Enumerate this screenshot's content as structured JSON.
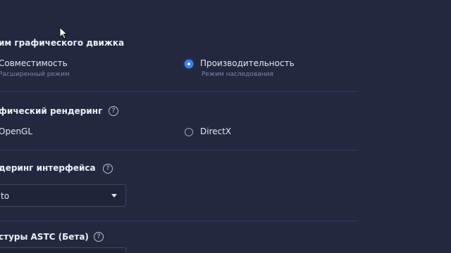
{
  "engine_mode": {
    "title": "им графического движка",
    "options": [
      {
        "label": "Совместимость",
        "sublabel": "Расширенный режим",
        "selected": false
      },
      {
        "label": "Производительность",
        "sublabel": "Режим наследования",
        "selected": true
      }
    ]
  },
  "graphics_rendering": {
    "title": "фический рендеринг",
    "help_icon": "?",
    "options": [
      {
        "label": "OpenGL",
        "selected": false
      },
      {
        "label": "DirectX",
        "selected": false
      }
    ]
  },
  "interface_rendering": {
    "title": "деринг интерфейса",
    "help_icon": "?",
    "select_value": "to"
  },
  "astc_textures": {
    "title": "стуры ASTC (Бета)",
    "help_icon": "?"
  },
  "colors": {
    "background": "#232840",
    "accent": "#2f7cf6",
    "divider": "#343a56"
  },
  "icons": [
    "help-circle-icon",
    "radio-icon",
    "chevron-down-icon",
    "mouse-cursor-icon"
  ]
}
